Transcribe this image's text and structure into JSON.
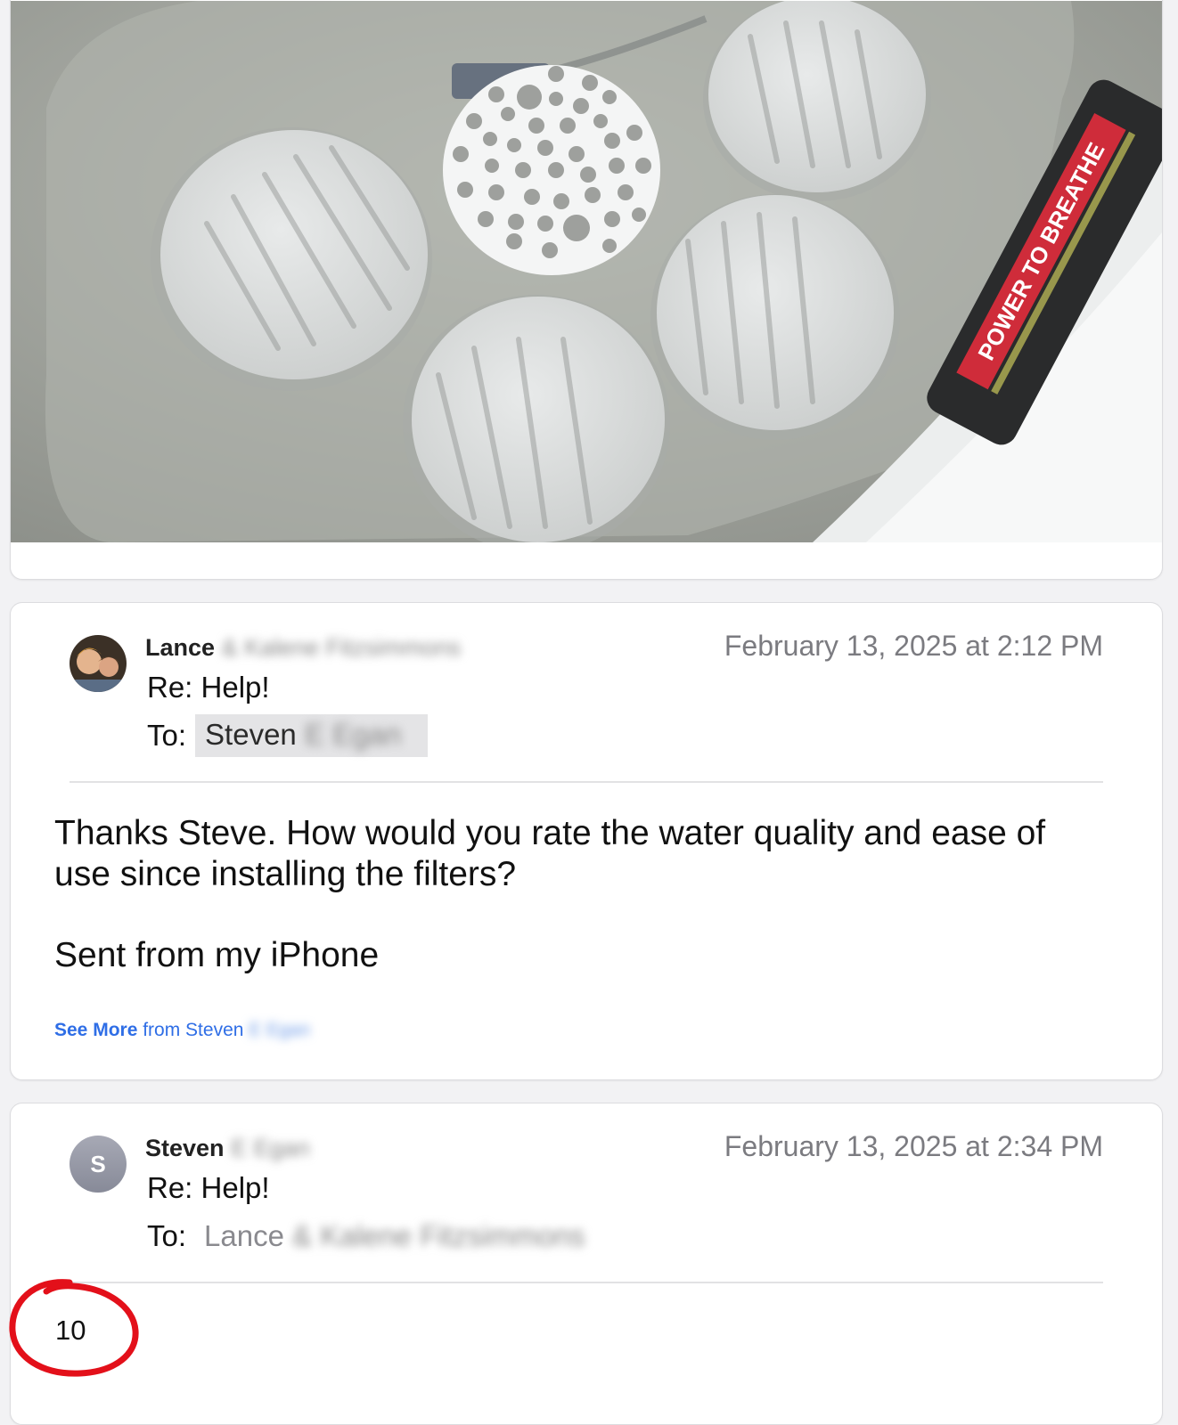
{
  "photo": {
    "alt": "Printed filter discs soaking in a basin",
    "bottle_label": "POWER TO BREATHE"
  },
  "messages": [
    {
      "sender_first": "Lance",
      "sender_blurred": "& Kalene Fitzsimmons",
      "date": "February 13, 2025 at 2:12 PM",
      "subject": "Re: Help!",
      "to_label": "To:",
      "to_first": "Steven",
      "to_blurred": "E Egan",
      "body": "Thanks Steve. How would you rate the water quality and ease of use since installing the filters?",
      "signature": "Sent from my iPhone",
      "see_more_bold": "See More",
      "see_more_rest": "from Steven",
      "see_more_blurred": "E Egan"
    },
    {
      "avatar_initial": "S",
      "sender_first": "Steven",
      "sender_blurred": "E Egan",
      "date": "February 13, 2025 at 2:34 PM",
      "subject": "Re: Help!",
      "to_label": "To:",
      "to_first": "Lance",
      "to_blurred": "& Kalene Fitzsimmons",
      "body": "10"
    }
  ],
  "colors": {
    "link": "#2f6ee6",
    "annotation": "#e3101a",
    "muted_text": "#7b7b80"
  }
}
